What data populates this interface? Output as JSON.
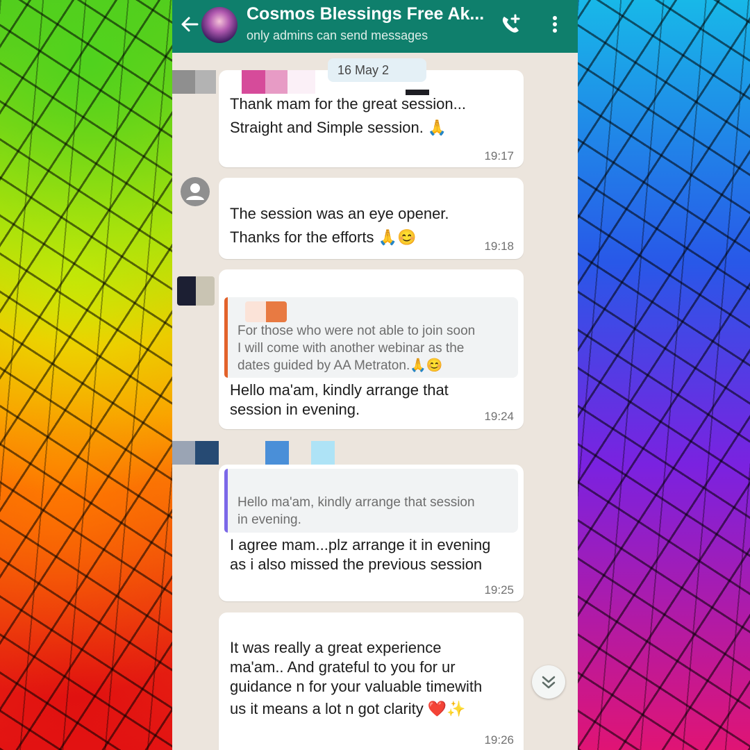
{
  "header": {
    "title": "Cosmos Blessings Free Ak...",
    "subtitle": "only admins can send messages",
    "back_icon": "arrow-left-icon",
    "call_icon": "add-call-icon",
    "menu_icon": "more-vertical-icon"
  },
  "chat": {
    "date_chip": "16 May 2",
    "messages": [
      {
        "text_lines": [
          "Thank mam for the great session...",
          "Straight and Simple session. 🙏"
        ],
        "time": "19:17"
      },
      {
        "text_lines": [
          "The session was an eye opener.",
          "Thanks for the efforts 🙏😊"
        ],
        "time": "19:18"
      },
      {
        "quote_lines": [
          "For those who were not able to join soon",
          "I  will come with another webinar as the",
          "dates guided by AA Metraton.🙏😊"
        ],
        "text_lines": [
          "Hello ma'am, kindly arrange that",
          "session in evening."
        ],
        "time": "19:24"
      },
      {
        "quote_lines": [
          "Hello ma'am, kindly arrange that session",
          "in evening."
        ],
        "text_lines": [
          "I agree mam...plz arrange it in evening",
          "as i also missed the previous session"
        ],
        "time": "19:25"
      },
      {
        "text_lines": [
          "It was really a great experience",
          "ma'am.. And grateful to you for ur",
          "guidance n for your valuable timewith",
          "us it means a lot n got clarity ❤️✨"
        ],
        "time": "19:26"
      }
    ]
  },
  "colors": {
    "header": "#0f7f6c",
    "chat_bg": "#ece5dd",
    "bubble": "#ffffff",
    "quote_bar_1": "#e2622b",
    "quote_bar_2": "#7b68e8"
  },
  "scroll_icon": "double-chevron-down-icon"
}
